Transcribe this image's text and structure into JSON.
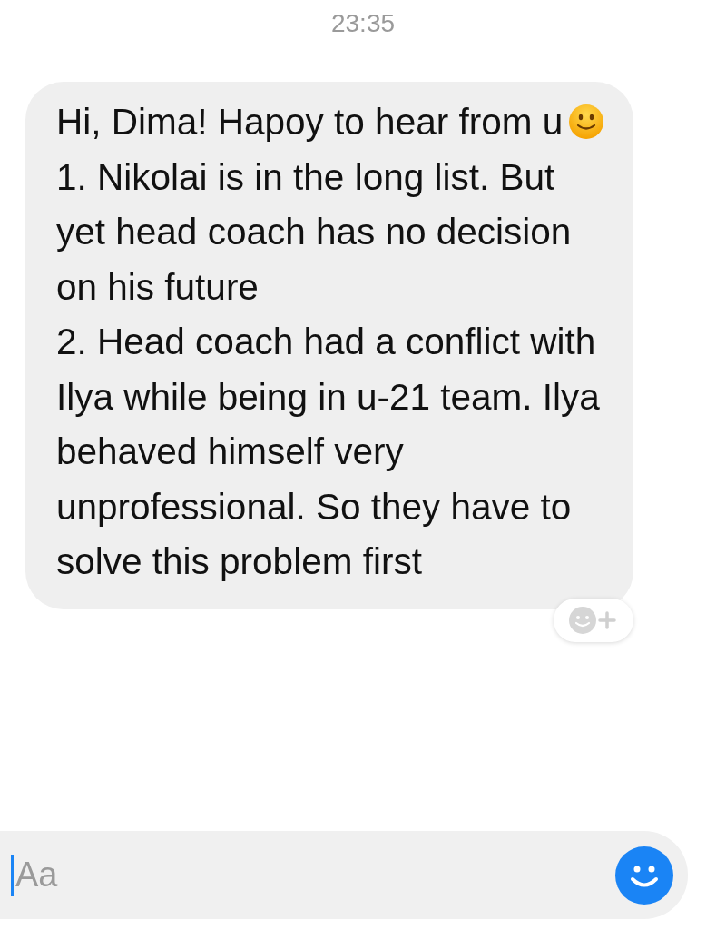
{
  "timestamp": "23:35",
  "message": {
    "paragraphs": [
      {
        "text": "Hi, Dima! Hapoy to hear from u",
        "emoji": true
      },
      {
        "text": "1. Nikolai is in the long list. But yet head coach has no decision on his future",
        "emoji": false
      },
      {
        "text": "2. Head coach had a conflict with Ilya while being in u-21 team. Ilya behaved himself very unprofessional. So they have to solve this problem first",
        "emoji": false
      }
    ]
  },
  "composer": {
    "placeholder": "Aa"
  }
}
